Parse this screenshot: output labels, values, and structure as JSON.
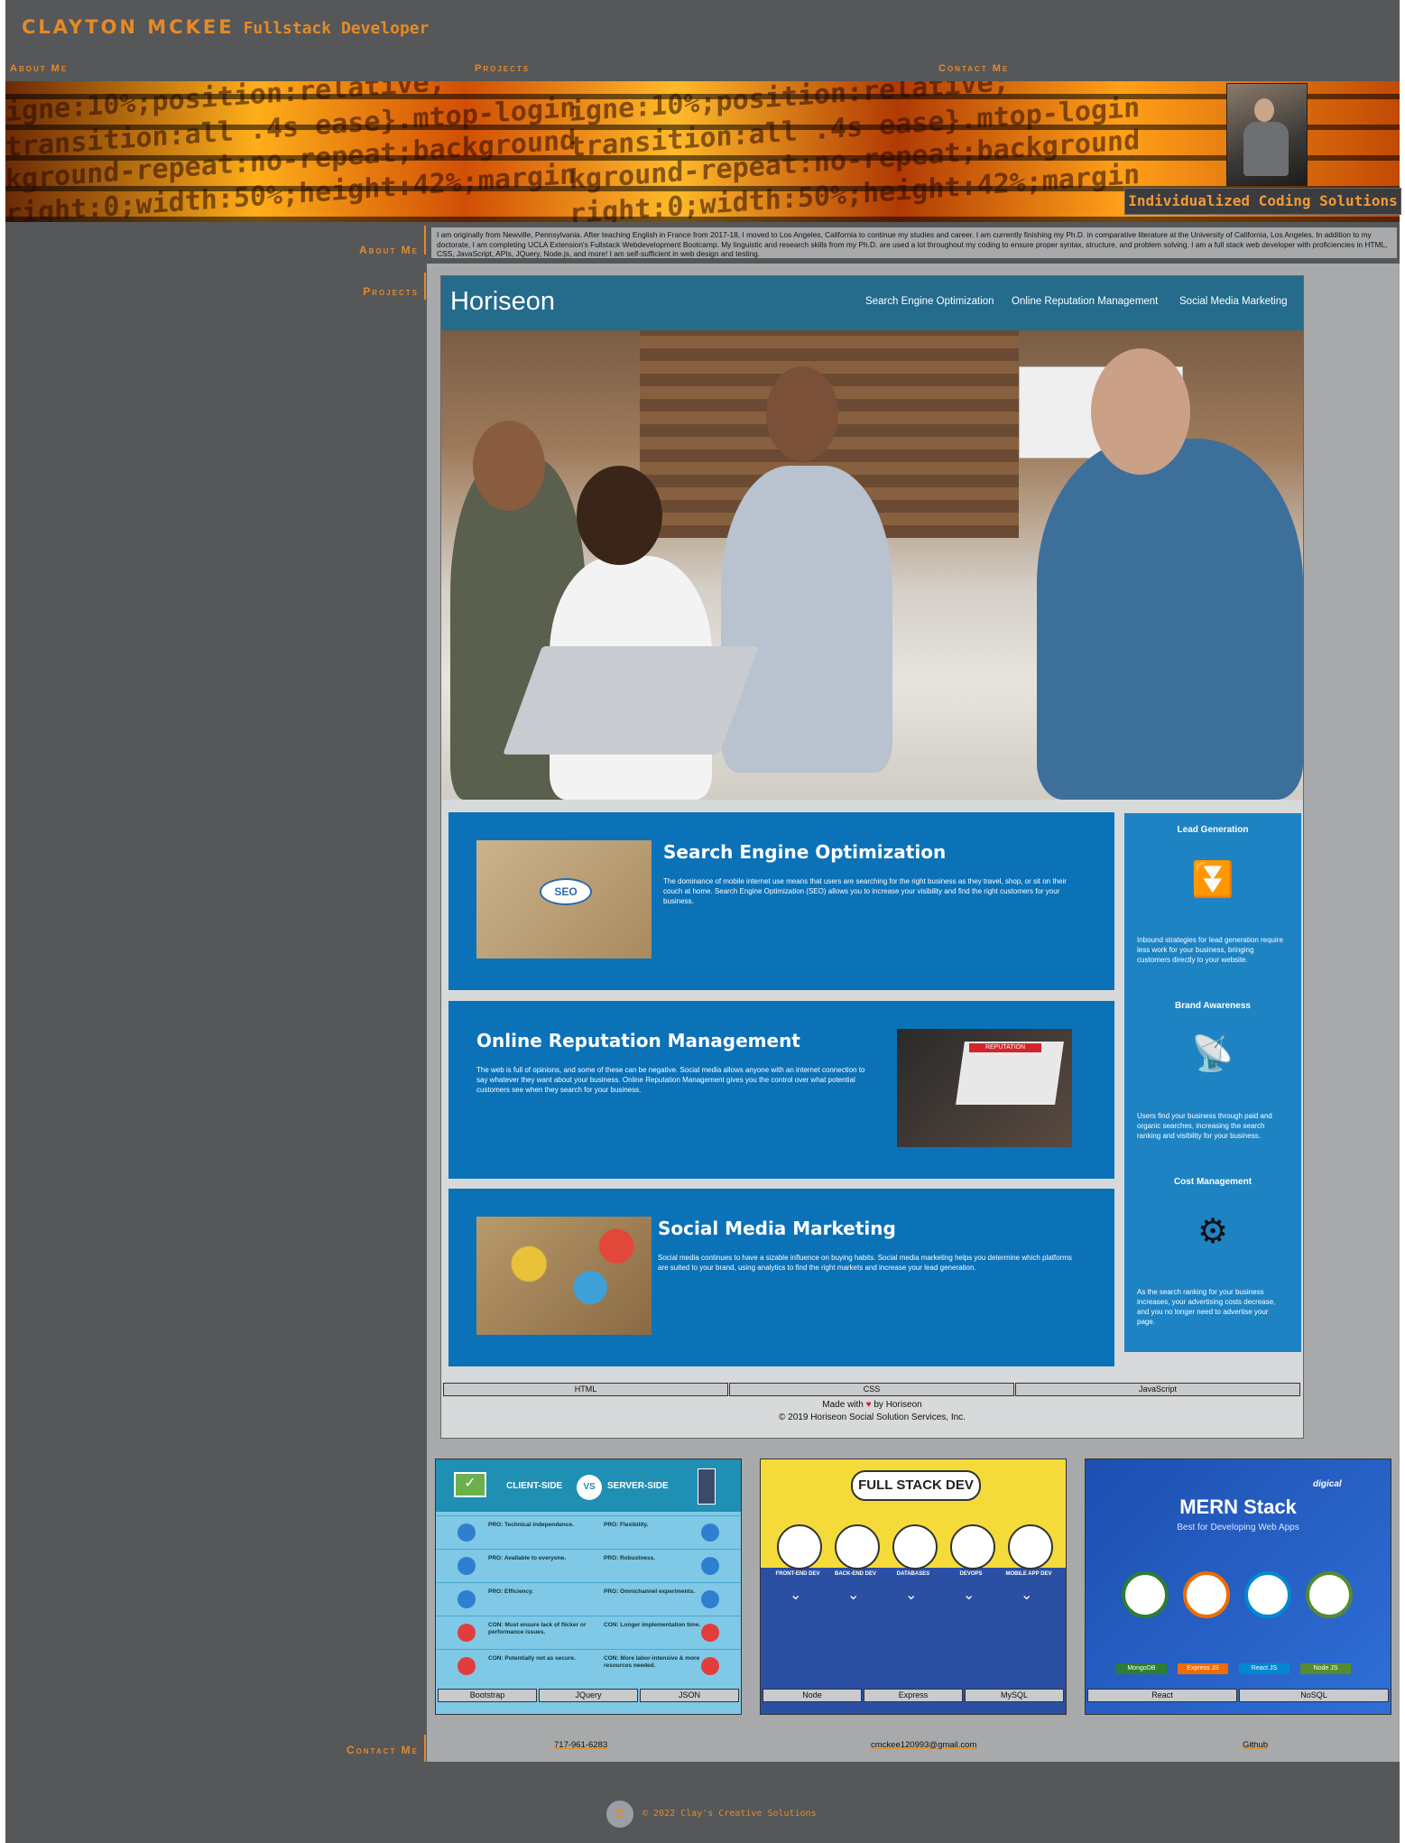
{
  "header": {
    "name": "CLAYTON MCKEE",
    "role": "Fullstack Developer",
    "nav": [
      "About Me",
      "Projects",
      "Contact Me"
    ],
    "tagline": "Individualized Coding Solutions",
    "banner_code": [
      "igne:10%;position:relative;",
      "transition:all .4s ease}.mtop-login",
      "kground-repeat:no-repeat;background",
      "right:0;width:50%;height:42%;margin"
    ]
  },
  "sections": {
    "about": "About Me",
    "projects": "Projects",
    "contact": "Contact Me"
  },
  "about_text": "I am originally from Newville, Pennsylvania. After teaching English in France from 2017-18, I moved to Los Angeles, California to continue my studies and career. I am currently finishing my Ph.D. in comparative literature at the University of California, Los Angeles. In addition to my doctorate, I am completing UCLA Extension's Fullstack Webdevelopment Bootcamp. My linguistic and research skills from my Ph.D. are used a lot throughout my coding to ensure proper syntax, structure, and problem solving. I am a full stack web developer with proficiencies in HTML, CSS, JavaScript, APIs, JQuery, Node.js, and more! I am self-sufficient in web design and testing.",
  "horiseon": {
    "logo": "Horiseon",
    "nav": [
      "Search Engine Optimization",
      "Online Reputation Management",
      "Social Media Marketing"
    ],
    "cards": [
      {
        "title": "Search Engine Optimization",
        "text": "The dominance of mobile internet use means that users are searching for the right business as they travel, shop, or sit on their couch at home. Search Engine Optimization (SEO) allows you to increase your visibility and find the right customers for your business."
      },
      {
        "title": "Online Reputation Management",
        "text": "The web is full of opinions, and some of these can be negative. Social media allows anyone with an internet connection to say whatever they want about your business. Online Reputation Management gives you the control over what potential customers see when they search for your business."
      },
      {
        "title": "Social Media Marketing",
        "text": "Social media continues to have a sizable influence on buying habits. Social media marketing helps you determine which platforms are suited to your brand, using analytics to find the right markets and increase your lead generation."
      }
    ],
    "benefits": [
      {
        "title": "Lead Generation",
        "icon": "funnel-icon",
        "text": "Inbound strategies for lead generation require less work for your business, bringing customers directly to your website."
      },
      {
        "title": "Brand Awareness",
        "icon": "broadcast-icon",
        "text": "Users find your business through paid and organic searches, increasing the search ranking and visibility for your business."
      },
      {
        "title": "Cost Management",
        "icon": "money-gears-icon",
        "text": "As the search ranking for your business increases, your advertising costs decrease, and you no longer need to advertise your page."
      }
    ],
    "thumb_labels": {
      "seo": "SEO",
      "reputation": "REPUTATION"
    },
    "tech": [
      "HTML",
      "CSS",
      "JavaScript"
    ],
    "footer_made": "Made with",
    "footer_by": "by Horiseon",
    "footer_copy": "© 2019 Horiseon Social Solution Services, Inc."
  },
  "projects": [
    {
      "name": "client-server",
      "left_label": "CLIENT-SIDE",
      "vs": "VS",
      "right_label": "SERVER-SIDE",
      "rows": [
        [
          "PRO: Technical independence.",
          "PRO: Flexibility."
        ],
        [
          "PRO: Available to everyone.",
          "PRO: Robustness."
        ],
        [
          "PRO: Efficiency.",
          "PRO: Omnichannel experiments."
        ],
        [
          "CON: Must ensure lack of flicker or performance issues.",
          "CON: Longer implementation time."
        ],
        [
          "CON: Potentially not as secure.",
          "CON: More labor-intensive & more resources needed."
        ]
      ],
      "tech": [
        "Bootstrap",
        "JQuery",
        "JSON"
      ]
    },
    {
      "name": "full-stack",
      "title": "FULL STACK DEV",
      "nodes": [
        "FRONT-END DEV",
        "BACK-END DEV",
        "DATABASES",
        "DEVOPS",
        "MOBILE APP DEV"
      ],
      "tech": [
        "Node",
        "Express",
        "MySQL"
      ]
    },
    {
      "name": "mern",
      "brand": "digical",
      "title": "MERN Stack",
      "subtitle": "Best for Developing Web Apps",
      "nodes": [
        "MongoDB",
        "Express JS",
        "React JS",
        "Node JS"
      ],
      "tech": [
        "React",
        "NoSQL"
      ]
    }
  ],
  "contact": {
    "phone": "717-961-6283",
    "email": "cmckee120993@gmail.com",
    "github": "Github"
  },
  "footer": {
    "logo_letter": "C",
    "text": "© 2022 Clay's Creative Solutions"
  },
  "colors": {
    "accent": "#e58a27",
    "page_bg": "#555759",
    "panel": "#a7a9ab",
    "horiseon_blue": "#0b72b8",
    "horiseon_header": "#246b8c"
  }
}
